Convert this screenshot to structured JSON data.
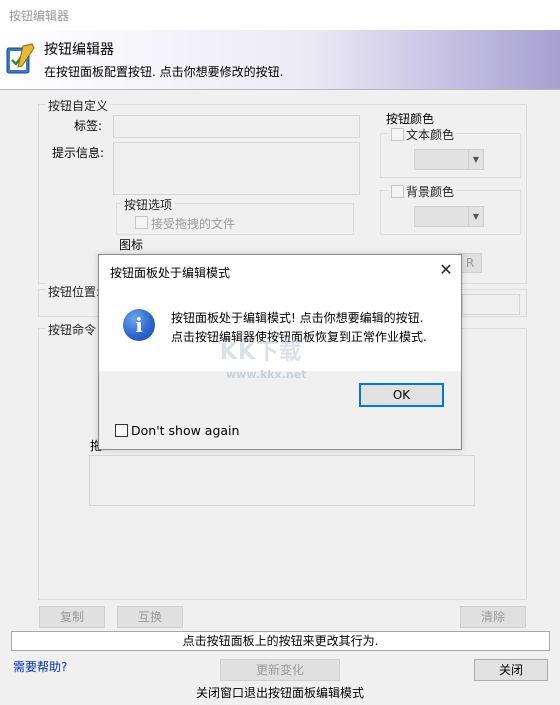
{
  "window": {
    "title": "按钮编辑器"
  },
  "banner": {
    "title": "按钮编辑器",
    "subtitle": "在按钮面板配置按钮. 点击你想要修改的按钮.",
    "icon": "edit-checklist-icon"
  },
  "custom_group": {
    "label": "按钮自定义",
    "label_field_label": "标签:",
    "label_field_value": "",
    "tooltip_label": "提示信息:",
    "tooltip_value": "",
    "options_label": "按钮选项",
    "accept_drag_label": "接受拖拽的文件",
    "icon_label": "图标"
  },
  "color_group": {
    "label": "按钮颜色",
    "text_color_label": "文本颜色",
    "bg_color_label": "背景颜色",
    "partial_label": "R"
  },
  "position_group": {
    "label": "按钮位置:"
  },
  "command_group": {
    "label": "按钮命令",
    "partial_label": "拖"
  },
  "buttons": {
    "copy": "复制",
    "swap": "互换",
    "clear": "清除",
    "update": "更新变化",
    "close": "关闭"
  },
  "status_text": "点击按钮面板上的按钮来更改其行为.",
  "help_link": "需要帮助?",
  "bottom_note": "关闭窗口退出按钮面板编辑模式",
  "dialog": {
    "title": "按钮面板处于编辑模式",
    "message_line1": "按钮面板处于编辑模式! 点击你想要编辑的按钮.",
    "message_line2": "点击按钮编辑器使按钮面板恢复到正常作业模式.",
    "ok_label": "OK",
    "dont_show_label": "Don't show again",
    "icon": "info-icon",
    "close_glyph": "✕"
  },
  "watermark": {
    "text": "KK下载",
    "url": "www.kkx.net"
  },
  "colors": {
    "accent": "#0078d7",
    "banner_gradient_end": "#a7a0d2",
    "info_blue": "#2a63c9"
  }
}
